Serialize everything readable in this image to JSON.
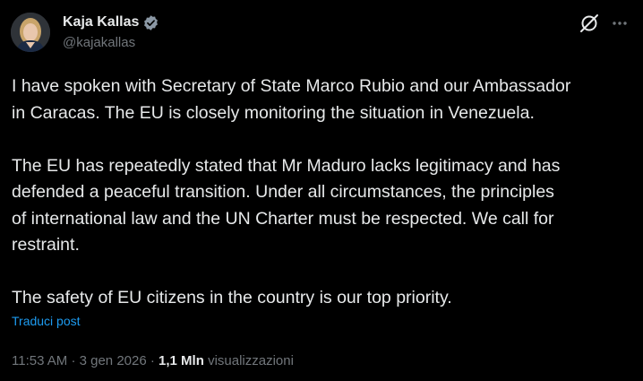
{
  "author": {
    "display_name": "Kaja Kallas",
    "handle": "@kajakallas",
    "verified": true
  },
  "post": {
    "paragraphs": [
      "I have spoken with Secretary of State Marco Rubio and our Ambassador\nin Caracas. The EU is closely monitoring the situation in Venezuela.",
      "The EU has repeatedly stated that Mr Maduro lacks legitimacy and has\ndefended a peaceful transition. Under all circumstances, the principles\nof international law and the UN Charter must be respected. We call for\nrestraint.",
      "The safety of EU citizens in the country is our top priority."
    ],
    "translate_label": "Traduci post"
  },
  "meta": {
    "time": "11:53 AM",
    "separator": "·",
    "date": "3 gen 2026",
    "views_count": "1,1 Mln",
    "views_label": "visualizzazioni"
  },
  "icons": {
    "verified": "verified-badge-icon",
    "grok": "grok-icon",
    "more": "more-icon"
  },
  "colors": {
    "background": "#000000",
    "text": "#e7e9ea",
    "secondary": "#71767b",
    "accent": "#1d9bf0"
  }
}
